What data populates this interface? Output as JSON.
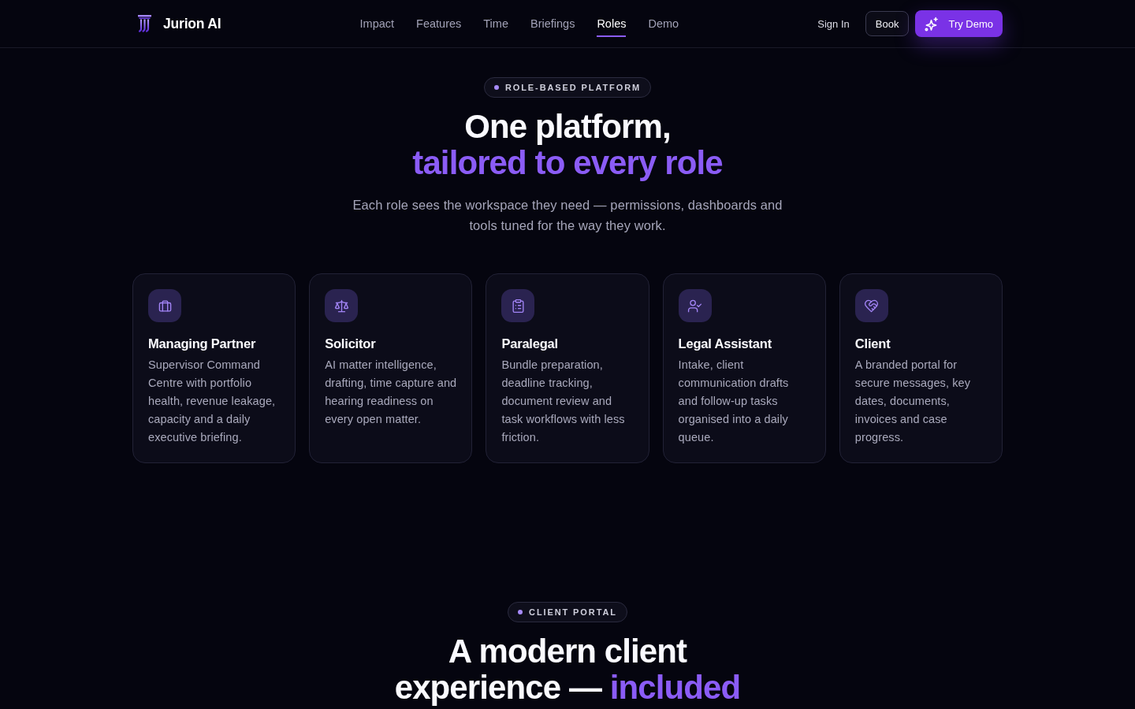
{
  "nav": {
    "brand": "Jurion AI",
    "links": [
      {
        "label": "Impact",
        "selected": false
      },
      {
        "label": "Features",
        "selected": false
      },
      {
        "label": "Time",
        "selected": false
      },
      {
        "label": "Briefings",
        "selected": false
      },
      {
        "label": "Roles",
        "selected": true
      },
      {
        "label": "Demo",
        "selected": false
      }
    ],
    "sign_in": "Sign In",
    "book": "Book",
    "try_demo": "Try Demo"
  },
  "roles_section": {
    "badge": "ROLE-BASED PLATFORM",
    "title": "One platform,",
    "title_accent": "tailored to every role",
    "subtitle": "Each role sees the workspace they need — permissions, dashboards and tools tuned for the way they work.",
    "cards": [
      {
        "title": "Managing Partner",
        "description": "Supervisor Command Centre with portfolio health, revenue leakage, capacity and a daily executive briefing."
      },
      {
        "title": "Solicitor",
        "description": "AI matter intelligence, drafting, time capture and hearing readiness on every open matter."
      },
      {
        "title": "Paralegal",
        "description": "Bundle preparation, deadline tracking, document review and task workflows with less friction."
      },
      {
        "title": "Legal Assistant",
        "description": "Intake, client communication drafts and follow-up tasks organised into a daily queue."
      },
      {
        "title": "Client",
        "description": "A branded portal for secure messages, key dates, documents, invoices and case progress."
      }
    ]
  },
  "portal_section": {
    "badge": "CLIENT PORTAL",
    "title": "A modern client experience —",
    "title_accent": "included"
  }
}
